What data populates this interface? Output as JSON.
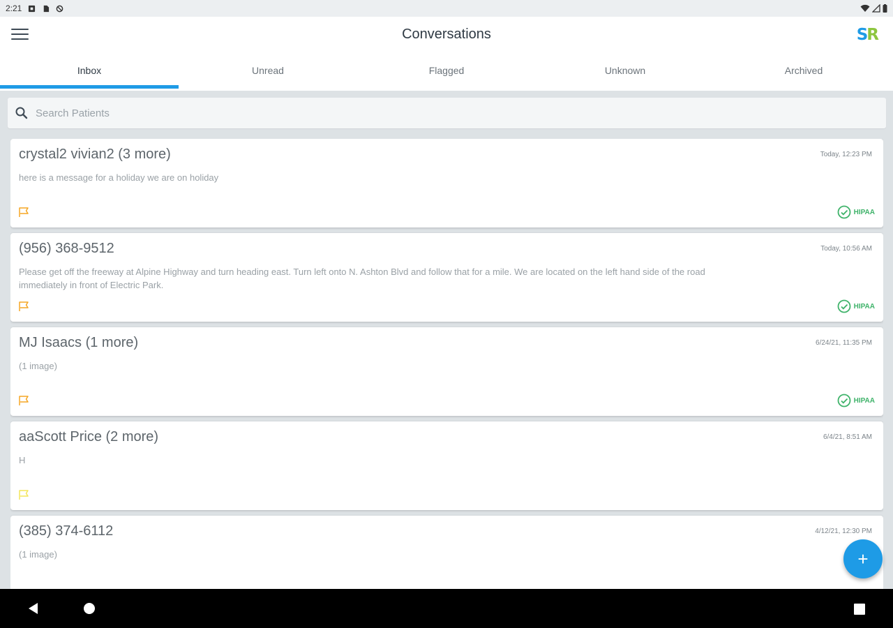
{
  "status_bar": {
    "time": "2:21"
  },
  "app_bar": {
    "title": "Conversations",
    "logo_left": "S",
    "logo_right": "R"
  },
  "tabs": [
    {
      "label": "Inbox",
      "active": true
    },
    {
      "label": "Unread",
      "active": false
    },
    {
      "label": "Flagged",
      "active": false
    },
    {
      "label": "Unknown",
      "active": false
    },
    {
      "label": "Archived",
      "active": false
    }
  ],
  "search": {
    "placeholder": "Search Patients",
    "value": ""
  },
  "conversations": [
    {
      "name": "crystal2 vivian2 (3 more)",
      "time": "Today, 12:23 PM",
      "message": "here is a message for a holiday we are on holiday",
      "flag_color": "#f5a623",
      "hipaa": "HIPAA"
    },
    {
      "name": "(956) 368-9512",
      "time": "Today, 10:56 AM",
      "message": "Please get off the freeway at Alpine Highway and turn heading east. Turn left onto N. Ashton Blvd and follow that for a mile. We are located on the left hand side of the road immediately in front of Electric Park.",
      "flag_color": "#f5a623",
      "hipaa": "HIPAA"
    },
    {
      "name": "MJ Isaacs (1 more)",
      "time": "6/24/21, 11:35 PM",
      "message": "(1 image)",
      "flag_color": "#f5a623",
      "hipaa": "HIPAA"
    },
    {
      "name": "aaScott Price (2 more)",
      "time": "6/4/21, 8:51 AM",
      "message": "H",
      "flag_color": "#f3e55a",
      "hipaa": ""
    },
    {
      "name": "(385) 374-6112",
      "time": "4/12/21, 12:30 PM",
      "message": "(1 image)",
      "flag_color": "#f5a623",
      "hipaa": ""
    }
  ],
  "fab": {
    "icon": "+"
  },
  "colors": {
    "accent": "#1e9be6",
    "hipaa_green": "#3fb36a",
    "logo_s": "#1e9be6",
    "logo_r": "#8dc63f"
  },
  "icons": [
    "menu-icon",
    "search-icon",
    "flag-icon",
    "check-circle-icon",
    "plus-icon",
    "back-icon",
    "home-icon",
    "recents-icon"
  ]
}
